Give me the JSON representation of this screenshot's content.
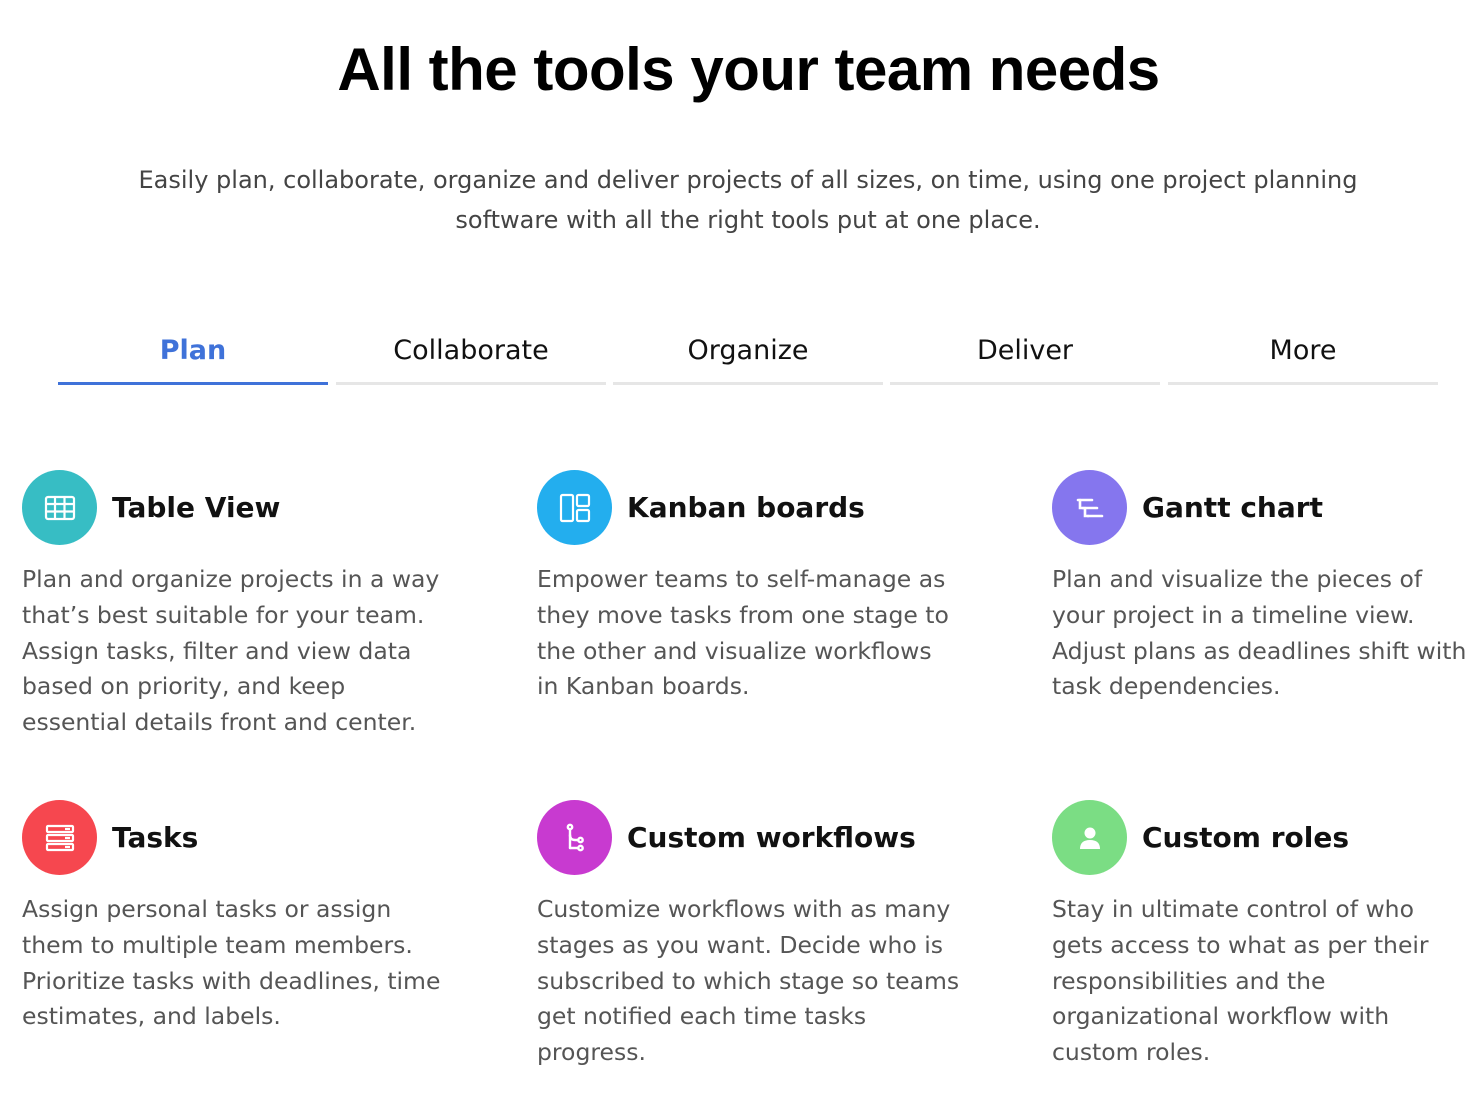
{
  "hero": {
    "title": "All the tools your team needs",
    "subtitle": "Easily plan, collaborate, organize and deliver projects of all sizes, on time, using one project planning software with all the right tools put at one place."
  },
  "tabs": [
    {
      "label": "Plan",
      "active": true
    },
    {
      "label": "Collaborate",
      "active": false
    },
    {
      "label": "Organize",
      "active": false
    },
    {
      "label": "Deliver",
      "active": false
    },
    {
      "label": "More",
      "active": false
    }
  ],
  "colors": {
    "accent": "#3f72d9",
    "table_view": "#37bdc4",
    "kanban": "#23aeee",
    "gantt": "#8576ee",
    "tasks": "#f6474f",
    "workflows": "#c83ad0",
    "roles": "#7bdd84"
  },
  "features": [
    {
      "title": "Table View",
      "icon": "table-icon",
      "description": "Plan and organize projects in a way that’s best suitable for your team. Assign tasks, filter and view data based on priority, and keep essential details front and center."
    },
    {
      "title": "Kanban boards",
      "icon": "kanban-icon",
      "description": "Empower teams to self-manage as they move tasks from one stage to the other and visualize workflows in Kanban boards."
    },
    {
      "title": "Gantt chart",
      "icon": "gantt-icon",
      "description": "Plan and visualize the pieces of your project in a timeline view. Adjust plans as deadlines shift with task dependencies."
    },
    {
      "title": "Tasks",
      "icon": "tasks-icon",
      "description": "Assign personal tasks or assign them to multiple team members. Prioritize tasks with deadlines, time estimates, and labels."
    },
    {
      "title": "Custom workflows",
      "icon": "workflow-icon",
      "description": "Customize workflows with as many stages as you want. Decide who is subscribed to which stage so teams get notified each time tasks progress."
    },
    {
      "title": "Custom roles",
      "icon": "user-icon",
      "description": "Stay in ultimate control of who gets access to what as per their responsibilities and the organizational workflow with custom roles."
    }
  ]
}
